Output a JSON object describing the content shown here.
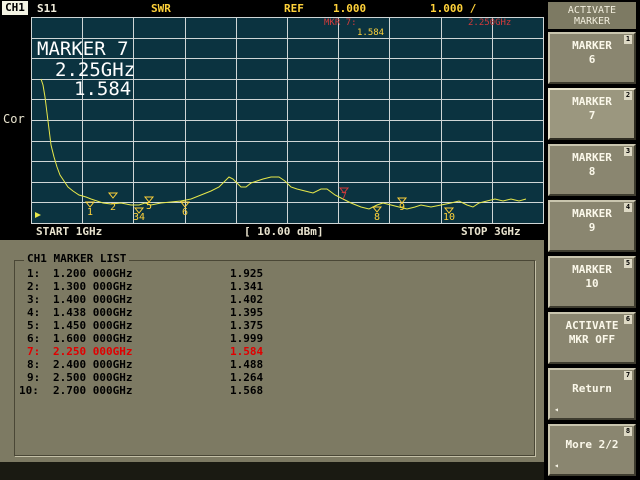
{
  "header": {
    "channel": "CH1",
    "param": "S11",
    "format": "SWR",
    "ref_label": "REF",
    "ref_value": "1.000",
    "scale_value": "1.000 /"
  },
  "plot": {
    "side_label": "Cor",
    "active_marker": {
      "name": "MARKER 7",
      "freq": "2.25GHz",
      "value": "1.584"
    },
    "mkr_readout_label": "MKR 7:",
    "mkr_readout_value": "1.584",
    "mkr_readout_freq": "2.250GHz",
    "footer": {
      "start": "START 1GHz",
      "power": "[ 10.00 dBm]",
      "stop": "STOP 3GHz"
    },
    "trace_color": "#e8e84a",
    "grid_color": "#cfd6d6",
    "marker_tags": [
      "1",
      "2",
      "34",
      "5",
      "6",
      "7",
      "8",
      "9",
      "10"
    ]
  },
  "softkeys": {
    "title_line1": "ACTIVATE",
    "title_line2": "MARKER",
    "keys": [
      {
        "l1": "MARKER",
        "l2": "6",
        "num": "1"
      },
      {
        "l1": "MARKER",
        "l2": "7",
        "num": "2"
      },
      {
        "l1": "MARKER",
        "l2": "8",
        "num": "3"
      },
      {
        "l1": "MARKER",
        "l2": "9",
        "num": "4"
      },
      {
        "l1": "MARKER",
        "l2": "10",
        "num": "5"
      },
      {
        "l1": "ACTIVATE",
        "l2": "MKR OFF",
        "num": "6"
      },
      {
        "l1": "Return",
        "l2": "",
        "num": "7"
      },
      {
        "l1": "More 2/2",
        "l2": "",
        "num": "8"
      }
    ]
  },
  "marker_list": {
    "title": "CH1 MARKER LIST",
    "highlight_color": "#e00000",
    "rows": [
      {
        "idx": "1:",
        "freq": "1.200 000GHz",
        "value": "1.925"
      },
      {
        "idx": "2:",
        "freq": "1.300 000GHz",
        "value": "1.341"
      },
      {
        "idx": "3:",
        "freq": "1.400 000GHz",
        "value": "1.402"
      },
      {
        "idx": "4:",
        "freq": "1.438 000GHz",
        "value": "1.395"
      },
      {
        "idx": "5:",
        "freq": "1.450 000GHz",
        "value": "1.375"
      },
      {
        "idx": "6:",
        "freq": "1.600 000GHz",
        "value": "1.999"
      },
      {
        "idx": "7:",
        "freq": "2.250 000GHz",
        "value": "1.584"
      },
      {
        "idx": "8:",
        "freq": "2.400 000GHz",
        "value": "1.488"
      },
      {
        "idx": "9:",
        "freq": "2.500 000GHz",
        "value": "1.264"
      },
      {
        "idx": "10:",
        "freq": "2.700 000GHz",
        "value": "1.568"
      }
    ]
  }
}
